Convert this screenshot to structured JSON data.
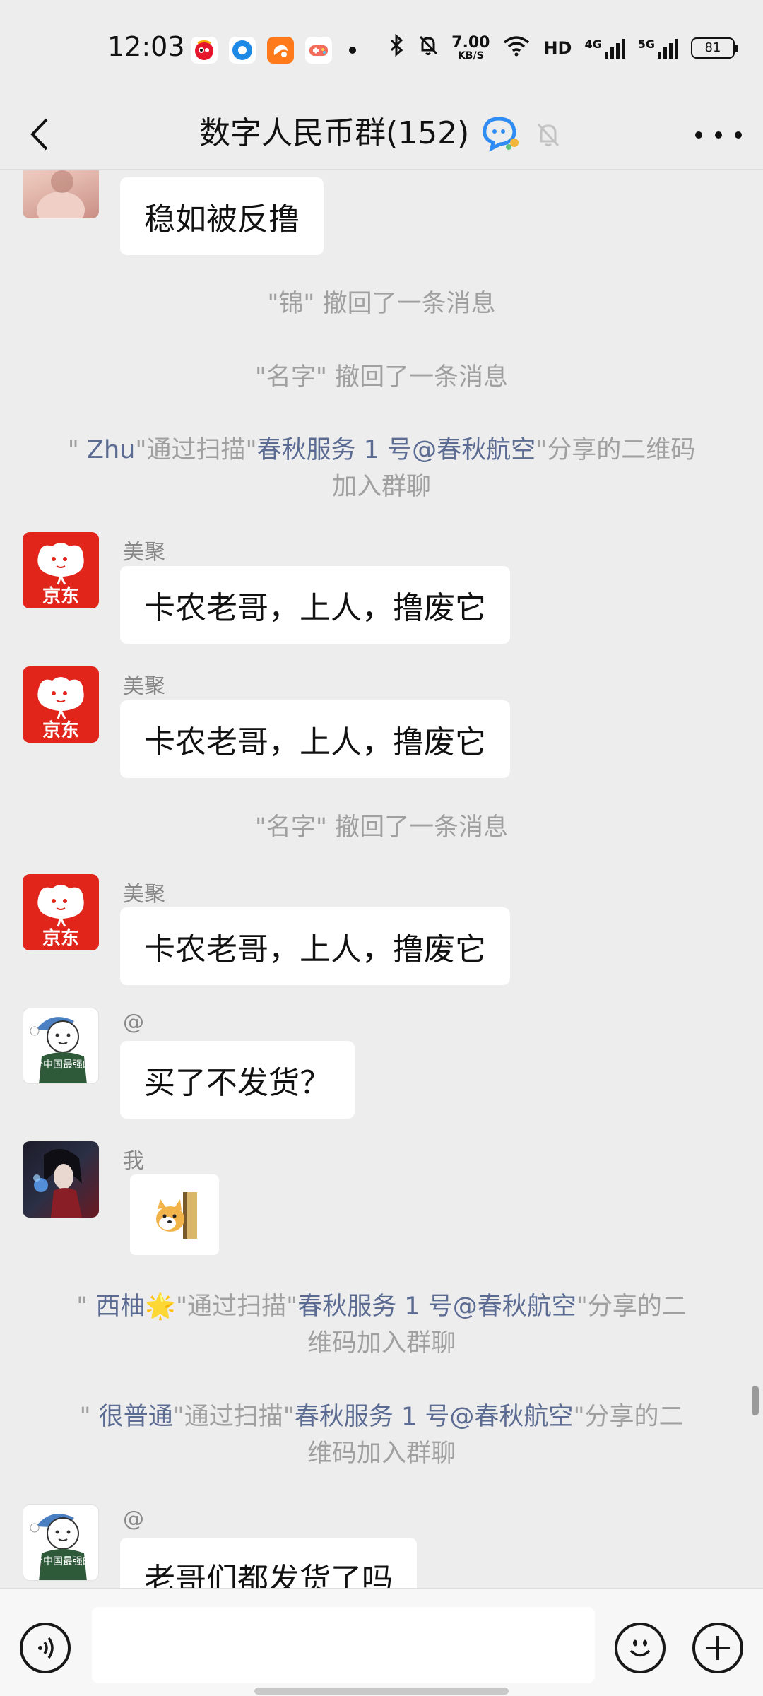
{
  "status_bar": {
    "time": "12:03",
    "net_speed": "7.00",
    "net_speed_unit": "KB/S",
    "hd_label": "HD",
    "net1_label": "4G",
    "net2_label": "5G",
    "battery": "81",
    "notif_icons": [
      "weibo-icon",
      "browser-icon",
      "uc-browser-icon",
      "game-icon"
    ]
  },
  "header": {
    "title": "数字人民币群(152)"
  },
  "messages": [
    {
      "type": "text",
      "sender": "",
      "avatar": "photo-avatar",
      "text": "稳如被反撸"
    },
    {
      "type": "system",
      "text": "\"锦\" 撤回了一条消息"
    },
    {
      "type": "system",
      "text": "\"名字\" 撤回了一条消息"
    },
    {
      "type": "system_join",
      "q1": "\" ",
      "name": "Zhu",
      "q2": "\"通过扫描\"",
      "source": "春秋服务 1 号@春秋航空",
      "rest1": "\"分享的二维码",
      "rest2": "加入群聊"
    },
    {
      "type": "text",
      "sender": "美聚",
      "avatar": "jd-avatar",
      "text": "卡农老哥，上人，撸废它"
    },
    {
      "type": "text",
      "sender": "美聚",
      "avatar": "jd-avatar",
      "text": "卡农老哥，上人，撸废它"
    },
    {
      "type": "system",
      "text": "\"名字\" 撤回了一条消息"
    },
    {
      "type": "text",
      "sender": "美聚",
      "avatar": "jd-avatar",
      "text": "卡农老哥，上人，撸废它"
    },
    {
      "type": "text",
      "sender": "@",
      "avatar": "cartoon-avatar",
      "text": "买了不发货？"
    },
    {
      "type": "sticker",
      "sender": "我",
      "avatar": "anime-avatar"
    },
    {
      "type": "system_join",
      "q1": "\" ",
      "name": "西柚",
      "emoji": "🌟",
      "q2": "\"通过扫描\"",
      "source": "春秋服务 1 号@春秋航空",
      "rest1": "\"分享的二",
      "rest2": "维码加入群聊"
    },
    {
      "type": "system_join",
      "q1": "\" ",
      "name": "很普通",
      "q2": "\"通过扫描\"",
      "source": "春秋服务 1 号@春秋航空",
      "rest1": "\"分享的二",
      "rest2": "维码加入群聊"
    },
    {
      "type": "text",
      "sender": "@",
      "avatar": "cartoon-avatar",
      "text": "老哥们都发货了吗"
    }
  ],
  "avatar_labels": {
    "jd": "京东",
    "cartoon": "全中国最强的"
  },
  "input_bar": {
    "placeholder": ""
  },
  "colors": {
    "background": "#ededed",
    "bubble": "#ffffff",
    "system_text": "#a0a0a0",
    "highlight_text": "#5b6b92",
    "jd_red": "#e1251b"
  }
}
